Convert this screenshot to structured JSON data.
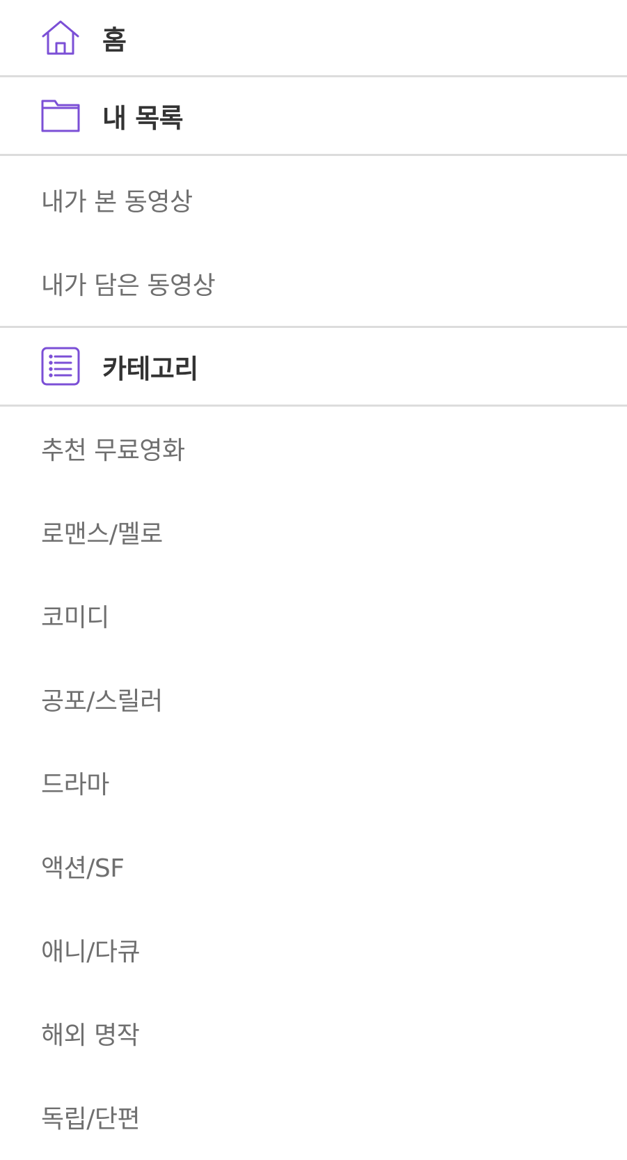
{
  "menu": {
    "home": {
      "label": "홈",
      "icon": "home-icon"
    },
    "my_list": {
      "label": "내 목록",
      "icon": "folder-icon",
      "items": [
        "내가 본 동영상",
        "내가 담은 동영상"
      ]
    },
    "category": {
      "label": "카테고리",
      "icon": "list-icon",
      "items": [
        "추천 무료영화",
        "로맨스/멜로",
        "코미디",
        "공포/스릴러",
        "드라마",
        "액션/SF",
        "애니/다큐",
        "해외 명작",
        "독립/단편"
      ]
    }
  },
  "colors": {
    "accent": "#7b4fd6",
    "divider": "#dcdcdc",
    "header_text": "#333333",
    "item_text": "#6f6f6f"
  }
}
